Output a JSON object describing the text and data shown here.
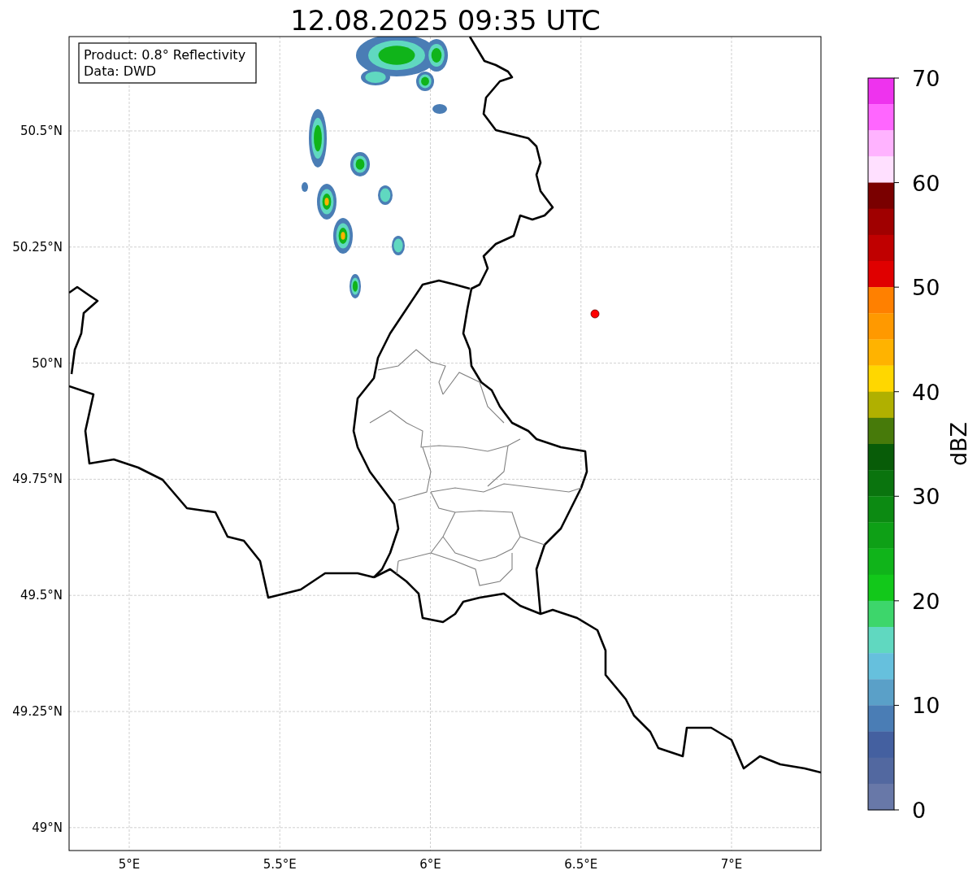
{
  "title": "12.08.2025 09:35 UTC",
  "legend": [
    "Product: 0.8° Reflectivity",
    "Data: DWD"
  ],
  "map": {
    "xticks": [
      "5°E",
      "5.5°E",
      "6°E",
      "6.5°E",
      "7°E"
    ],
    "yticks": [
      "50.5°N",
      "50.25°N",
      "50°N",
      "49.75°N",
      "49.5°N",
      "49.25°N",
      "49°N"
    ]
  },
  "colorbar": {
    "label": "dBZ",
    "ticks": [
      "70",
      "60",
      "50",
      "40",
      "30",
      "20",
      "10",
      "0"
    ],
    "segments": [
      {
        "color": "#ee33ee"
      },
      {
        "color": "#ff66ff"
      },
      {
        "color": "#ffb3ff"
      },
      {
        "color": "#ffe0ff"
      },
      {
        "color": "#7a0000"
      },
      {
        "color": "#a00000"
      },
      {
        "color": "#c00000"
      },
      {
        "color": "#e00000"
      },
      {
        "color": "#ff8000"
      },
      {
        "color": "#ff9900"
      },
      {
        "color": "#ffb300"
      },
      {
        "color": "#ffd700"
      },
      {
        "color": "#b0b000"
      },
      {
        "color": "#477a0a"
      },
      {
        "color": "#085c08"
      },
      {
        "color": "#0a740e"
      },
      {
        "color": "#0c8a12"
      },
      {
        "color": "#0ea016"
      },
      {
        "color": "#10b41a"
      },
      {
        "color": "#12c81a"
      },
      {
        "color": "#3dd66b"
      },
      {
        "color": "#60d8c0"
      },
      {
        "color": "#66c0dd"
      },
      {
        "color": "#5aa0c8"
      },
      {
        "color": "#4a7db5"
      },
      {
        "color": "#4460a0"
      },
      {
        "color": "#5268a0"
      },
      {
        "color": "#6878a8"
      }
    ]
  }
}
